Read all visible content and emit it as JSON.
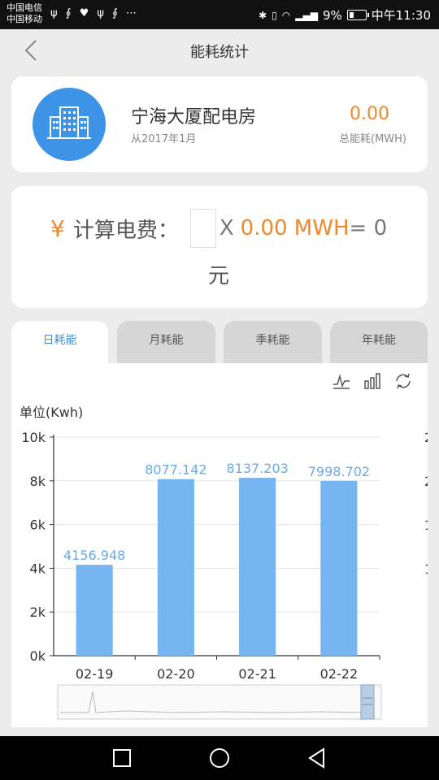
{
  "status": {
    "carrier1": "中国电信",
    "carrier2": "中国移动",
    "left_icons": "ψ ∮ ♥ ψ ∮ ⋯",
    "battery": "9%",
    "time": "中午11:30"
  },
  "nav": {
    "title": "能耗统计"
  },
  "building": {
    "name": "宁海大厦配电房",
    "since": "从2017年1月",
    "total_value": "0.00",
    "total_label": "总能耗(MWH)"
  },
  "calc": {
    "yen": "¥",
    "label": "计算电费：",
    "times": "X",
    "kwh": "0.00 MWH",
    "equals": "= 0",
    "unit": "元"
  },
  "tabs": [
    "日耗能",
    "月耗能",
    "季耗能",
    "年耗能"
  ],
  "active_tab": 0,
  "colors": {
    "accent": "#3d94e6",
    "orange": "#f0882b",
    "bar": "#76b5f0"
  },
  "chart_data": {
    "type": "bar",
    "unit_label": "单位(Kwh)",
    "categories": [
      "02-19",
      "02-20",
      "02-21",
      "02-22"
    ],
    "values": [
      4156.948,
      8077.142,
      8137.203,
      7998.702
    ],
    "value_labels": [
      "4156.948",
      "8077.142",
      "8137.203",
      "7998.702"
    ],
    "ylim": [
      0,
      10000
    ],
    "yticks": [
      "0k",
      "2k",
      "4k",
      "6k",
      "8k",
      "10k"
    ],
    "grid": true
  }
}
